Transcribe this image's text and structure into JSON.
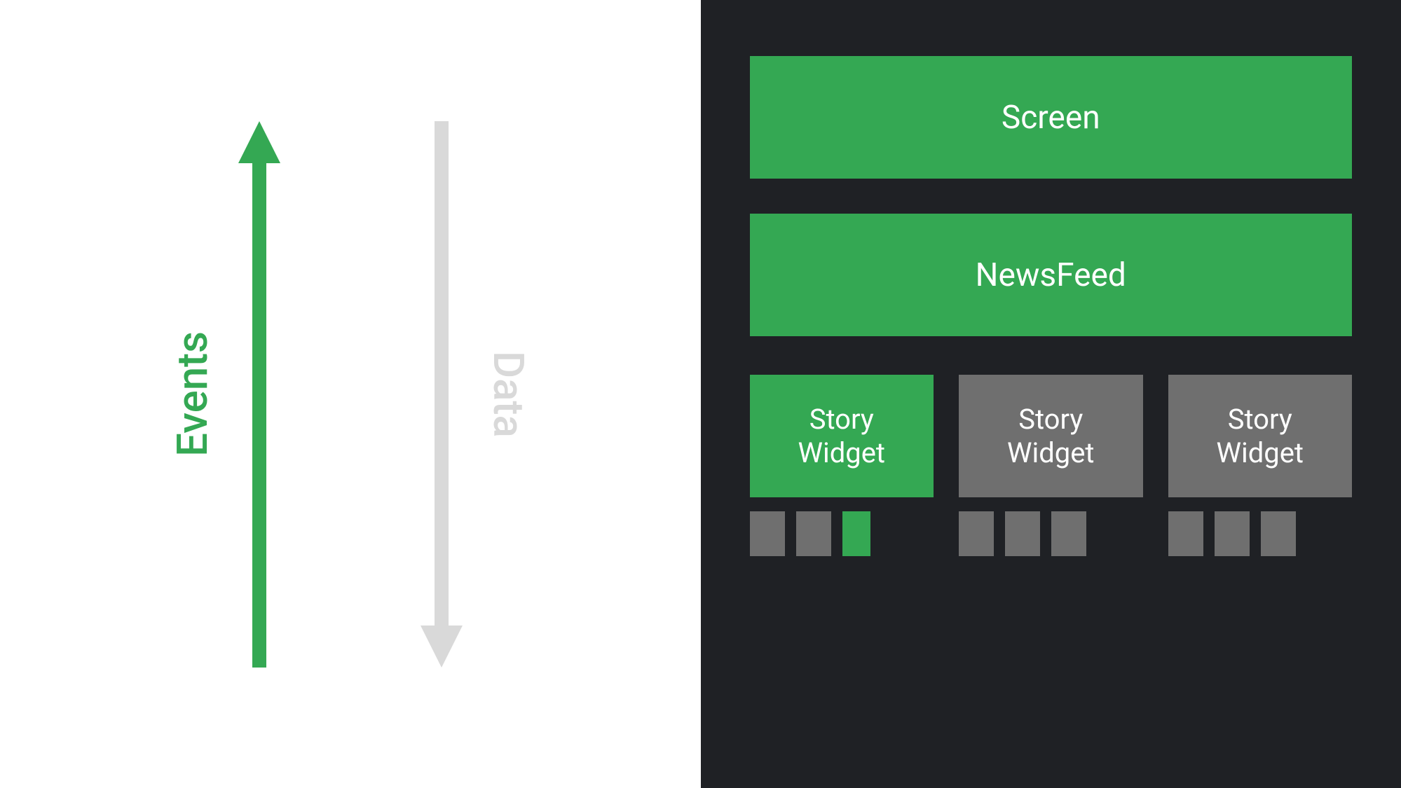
{
  "arrows": {
    "events": {
      "label": "Events",
      "color": "#34a853",
      "direction": "up"
    },
    "data": {
      "label": "Data",
      "color": "#d9d9d9",
      "direction": "down"
    }
  },
  "boxes": {
    "screen": "Screen",
    "newsfeed": "NewsFeed"
  },
  "widgets": [
    {
      "label_line1": "Story",
      "label_line2": "Widget",
      "active": true,
      "small_boxes": [
        {
          "active": false
        },
        {
          "active": false
        },
        {
          "active": true
        }
      ]
    },
    {
      "label_line1": "Story",
      "label_line2": "Widget",
      "active": false,
      "small_boxes": [
        {
          "active": false
        },
        {
          "active": false
        },
        {
          "active": false
        }
      ]
    },
    {
      "label_line1": "Story",
      "label_line2": "Widget",
      "active": false,
      "small_boxes": [
        {
          "active": false
        },
        {
          "active": false
        },
        {
          "active": false
        }
      ]
    }
  ]
}
